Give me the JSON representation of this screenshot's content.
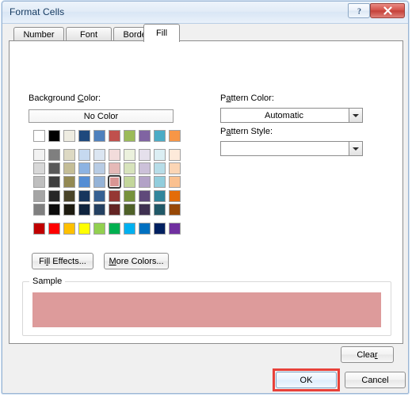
{
  "window": {
    "title": "Format Cells",
    "help_button": "?",
    "help_icon": "question-mark-icon",
    "close_icon": "close-x-icon"
  },
  "tabs": [
    {
      "label": "Number",
      "active": false
    },
    {
      "label": "Font",
      "active": false
    },
    {
      "label": "Border",
      "active": false
    },
    {
      "label": "Fill",
      "active": true
    }
  ],
  "fill_tab": {
    "background_color_label": "Background Color:",
    "background_color_label_accel": "C",
    "no_color_button": "No Color",
    "fill_effects_button": "Fill Effects...",
    "fill_effects_accel": "l",
    "more_colors_button": "More Colors...",
    "more_colors_accel": "M",
    "pattern_color_label": "Pattern Color:",
    "pattern_color_accel": "a",
    "pattern_color_value": "Automatic",
    "pattern_style_label": "Pattern Style:",
    "pattern_style_accel": "a",
    "pattern_style_value": "",
    "dropdown_icon": "chevron-down-icon"
  },
  "palette": {
    "theme_row": [
      "#ffffff",
      "#000000",
      "#eeece1",
      "#1f497d",
      "#4f81bd",
      "#c0504d",
      "#9bbb59",
      "#8064a2",
      "#4bacc6",
      "#f79646"
    ],
    "tint_rows": [
      [
        "#f2f2f2",
        "#7f7f7f",
        "#ddd9c3",
        "#c6d9f0",
        "#dbe5f1",
        "#f2dcdb",
        "#ebf1dd",
        "#e5e0ec",
        "#dbeef3",
        "#fdeada"
      ],
      [
        "#d8d8d8",
        "#595959",
        "#c4bd97",
        "#8db3e2",
        "#b8cce4",
        "#e5b9b7",
        "#d7e3bc",
        "#ccc1d9",
        "#b7dde8",
        "#fbd5b5"
      ],
      [
        "#bfbfbf",
        "#3f3f3f",
        "#938953",
        "#548dd4",
        "#95b3d7",
        "#d99694",
        "#c3d69b",
        "#b2a2c7",
        "#92cddc",
        "#fac08f"
      ],
      [
        "#a5a5a5",
        "#262626",
        "#494429",
        "#17365d",
        "#366092",
        "#953734",
        "#76923c",
        "#5f497a",
        "#31859b",
        "#e36c09"
      ],
      [
        "#7f7f7f",
        "#0c0c0c",
        "#1d1b10",
        "#0f243e",
        "#244061",
        "#632423",
        "#4f6128",
        "#3f3151",
        "#205867",
        "#974806"
      ]
    ],
    "standard_row": [
      "#c00000",
      "#ff0000",
      "#ffc000",
      "#ffff00",
      "#92d050",
      "#00b050",
      "#00b0f0",
      "#0070c0",
      "#002060",
      "#7030a0"
    ],
    "selected_row": 3,
    "selected_col": 6,
    "selected_color": "#d99694"
  },
  "sample": {
    "legend": "Sample",
    "fill_color": "#dd9b9b"
  },
  "footer": {
    "clear_button": "Clear",
    "clear_accel": "r",
    "ok_button": "OK",
    "cancel_button": "Cancel",
    "highlight_color": "#e8413a"
  }
}
